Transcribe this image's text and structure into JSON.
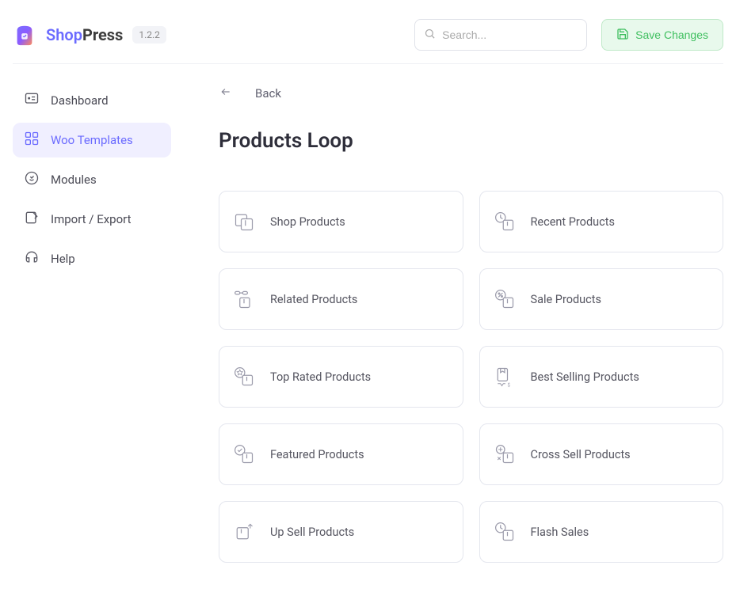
{
  "header": {
    "brand_shop": "Shop",
    "brand_press": "Press",
    "version": "1.2.2",
    "search_placeholder": "Search...",
    "save_label": "Save Changes"
  },
  "sidebar": {
    "items": [
      {
        "label": "Dashboard",
        "active": false
      },
      {
        "label": "Woo Templates",
        "active": true
      },
      {
        "label": "Modules",
        "active": false
      },
      {
        "label": "Import / Export",
        "active": false
      },
      {
        "label": "Help",
        "active": false
      }
    ]
  },
  "main": {
    "back_label": "Back",
    "title": "Products Loop",
    "cards": [
      {
        "label": "Shop Products"
      },
      {
        "label": "Recent Products"
      },
      {
        "label": "Related Products"
      },
      {
        "label": "Sale Products"
      },
      {
        "label": "Top Rated Products"
      },
      {
        "label": "Best Selling Products"
      },
      {
        "label": "Featured Products"
      },
      {
        "label": "Cross Sell Products"
      },
      {
        "label": "Up Sell Products"
      },
      {
        "label": "Flash Sales"
      }
    ]
  }
}
